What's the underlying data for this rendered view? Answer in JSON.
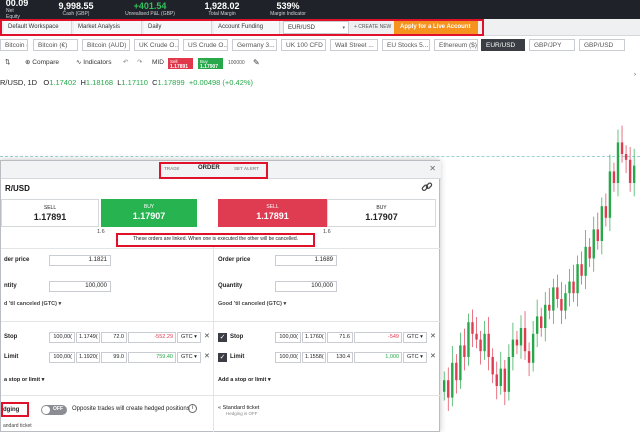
{
  "account": {
    "items": [
      {
        "value": "00.09",
        "label": "Net Equity",
        "green": false
      },
      {
        "value": "9,998.55",
        "label": "Cash (GBP)",
        "green": false
      },
      {
        "value": "+401.54",
        "label": "Unrealised P&L (GBP)",
        "green": true
      },
      {
        "value": "1,928.02",
        "label": "Total Margin",
        "green": false
      },
      {
        "value": "539%",
        "label": "Margin Indicator",
        "green": false
      }
    ]
  },
  "workspace": {
    "tabs": [
      "Default Workspace",
      "Market Analysis",
      "Daily",
      "Account Funding"
    ],
    "instrument_select": "EUR/USD",
    "create_new": "+ CREATE NEW",
    "live_account": "Apply for a Live Account"
  },
  "instruments": [
    "Bitcoin (£)",
    "Bitcoin (€)",
    "Bitcoin (AUD)",
    "UK Crude O...",
    "US Crude O...",
    "Germany 3...",
    "UK 100 CFD",
    "Wall Street ...",
    "EU Stocks 5...",
    "Ethereum ($)",
    "EUR/USD",
    "GBP/JPY",
    "GBP/USD"
  ],
  "chart_toolbar": {
    "compare": "Compare",
    "indicators": "Indicators",
    "mid": "MID",
    "sell_label": "Sell",
    "sell_price": "1.17891",
    "buy_label": "Buy",
    "buy_price": "1.17907",
    "volume": "100000"
  },
  "quote": {
    "symbol": "R/USD, 1D",
    "open": "1.17402",
    "high": "1.18168",
    "low": "1.17110",
    "close": "1.17899",
    "change": "+0.00498 (+0.42%)"
  },
  "order_ticket": {
    "tabs": [
      "TRADE",
      "ORDER",
      "SET ALERT"
    ],
    "title": "R/USD",
    "linked_note": "These orders are linked. When one is executed the other will be cancelled.",
    "left": {
      "sell_label": "SELL",
      "sell_price": "1.17891",
      "buy_label": "BUY",
      "buy_price": "1.17907",
      "spread": "1.6",
      "order_price_label": "der price",
      "order_price": "1.1821",
      "quantity_label": "ntity",
      "quantity": "100,000",
      "validity": "d 'til canceled (GTC)",
      "stop": {
        "label": "Stop",
        "qty": "100,00(",
        "price": "1.1749(",
        "points": "72.0",
        "pnl": "-552.29",
        "gtc": "GTC"
      },
      "limit": {
        "label": "Limit",
        "qty": "100,00(",
        "price": "1.1920(",
        "points": "99.0",
        "pnl": "759.40",
        "gtc": "GTC"
      },
      "add_stop": "a stop or limit",
      "hedging_label": "dging",
      "toggle": "OFF",
      "hedge_note": "Opposite trades will create hedged positions",
      "std_ticket": "andard ticket"
    },
    "right": {
      "sell_label": "SELL",
      "sell_price": "1.17891",
      "buy_label": "BUY",
      "buy_price": "1.17907",
      "spread": "1.6",
      "order_price_label": "Order price",
      "order_price": "1.1689",
      "quantity_label": "Quantity",
      "quantity": "100,000",
      "validity": "Good 'til canceled (GTC)",
      "stop": {
        "label": "Stop",
        "qty": "100,00(",
        "price": "1.1760(",
        "points": "71.6",
        "pnl": "-549",
        "gtc": "GTC"
      },
      "limit": {
        "label": "Limit",
        "qty": "100,00(",
        "price": "1.1558(",
        "points": "130.4",
        "pnl": "1,000",
        "gtc": "GTC"
      },
      "add_stop": "Add a stop or limit",
      "std_ticket": "Standard ticket",
      "std_sub": "Hedging is OFF"
    }
  },
  "colors": {
    "accent_orange": "#f6921e",
    "buy_green": "#27b34f",
    "sell_red": "#df3b51",
    "highlight": "#e0112b"
  },
  "chart_data": {
    "type": "candlestick",
    "values_close": [
      1.142,
      1.139,
      1.145,
      1.142,
      1.148,
      1.146,
      1.152,
      1.15,
      1.149,
      1.147,
      1.15,
      1.146,
      1.143,
      1.141,
      1.144,
      1.14,
      1.146,
      1.149,
      1.148,
      1.151,
      1.147,
      1.145,
      1.15,
      1.153,
      1.151,
      1.155,
      1.154,
      1.158,
      1.156,
      1.154,
      1.157,
      1.159,
      1.157,
      1.162,
      1.16,
      1.165,
      1.163,
      1.168,
      1.166,
      1.172,
      1.17,
      1.178,
      1.176,
      1.183,
      1.181,
      1.18,
      1.176,
      1.179
    ]
  }
}
